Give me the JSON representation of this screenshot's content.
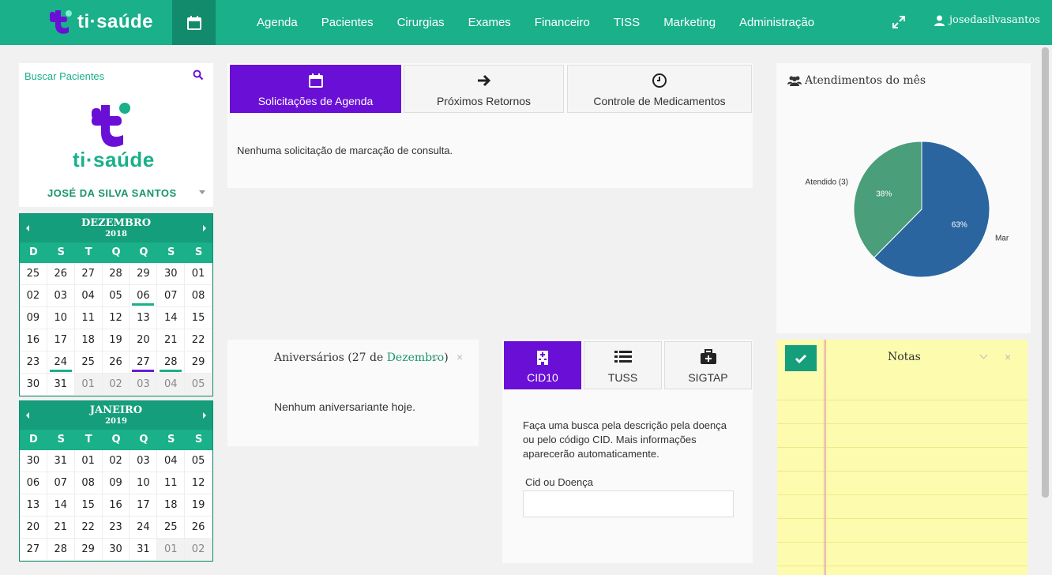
{
  "app": {
    "brand": "ti·saúde",
    "user": "josedasilvasantos"
  },
  "nav": [
    "Agenda",
    "Pacientes",
    "Cirurgias",
    "Exames",
    "Financeiro",
    "TISS",
    "Marketing",
    "Administração"
  ],
  "sidebar": {
    "search_label": "Buscar Pacientes",
    "patient_brand": "ti·saúde",
    "patient_name": "JOSÉ DA SILVA SANTOS"
  },
  "calendar_dec": {
    "month": "DEZEMBRO",
    "year": "2018",
    "dow": [
      "D",
      "S",
      "T",
      "Q",
      "Q",
      "S",
      "S"
    ],
    "days": [
      {
        "d": "25"
      },
      {
        "d": "26"
      },
      {
        "d": "27"
      },
      {
        "d": "28"
      },
      {
        "d": "29"
      },
      {
        "d": "30"
      },
      {
        "d": "01"
      },
      {
        "d": "02"
      },
      {
        "d": "03"
      },
      {
        "d": "04"
      },
      {
        "d": "05"
      },
      {
        "d": "06",
        "mark": "g"
      },
      {
        "d": "07"
      },
      {
        "d": "08"
      },
      {
        "d": "09"
      },
      {
        "d": "10"
      },
      {
        "d": "11"
      },
      {
        "d": "12"
      },
      {
        "d": "13"
      },
      {
        "d": "14"
      },
      {
        "d": "15"
      },
      {
        "d": "16"
      },
      {
        "d": "17"
      },
      {
        "d": "18"
      },
      {
        "d": "19"
      },
      {
        "d": "20"
      },
      {
        "d": "21"
      },
      {
        "d": "22"
      },
      {
        "d": "23"
      },
      {
        "d": "24",
        "mark": "g"
      },
      {
        "d": "25"
      },
      {
        "d": "26"
      },
      {
        "d": "27",
        "mark": "p"
      },
      {
        "d": "28",
        "mark": "g"
      },
      {
        "d": "29"
      },
      {
        "d": "30"
      },
      {
        "d": "31"
      },
      {
        "d": "01",
        "out": true
      },
      {
        "d": "02",
        "out": true
      },
      {
        "d": "03",
        "out": true
      },
      {
        "d": "04",
        "out": true
      },
      {
        "d": "05",
        "out": true
      }
    ]
  },
  "calendar_jan": {
    "month": "JANEIRO",
    "year": "2019",
    "dow": [
      "D",
      "S",
      "T",
      "Q",
      "Q",
      "S",
      "S"
    ],
    "days": [
      {
        "d": "30"
      },
      {
        "d": "31"
      },
      {
        "d": "01"
      },
      {
        "d": "02"
      },
      {
        "d": "03"
      },
      {
        "d": "04"
      },
      {
        "d": "05"
      },
      {
        "d": "06"
      },
      {
        "d": "07"
      },
      {
        "d": "08"
      },
      {
        "d": "09"
      },
      {
        "d": "10"
      },
      {
        "d": "11"
      },
      {
        "d": "12"
      },
      {
        "d": "13"
      },
      {
        "d": "14"
      },
      {
        "d": "15"
      },
      {
        "d": "16"
      },
      {
        "d": "17"
      },
      {
        "d": "18"
      },
      {
        "d": "19"
      },
      {
        "d": "20"
      },
      {
        "d": "21"
      },
      {
        "d": "22"
      },
      {
        "d": "23"
      },
      {
        "d": "24"
      },
      {
        "d": "25"
      },
      {
        "d": "26"
      },
      {
        "d": "27"
      },
      {
        "d": "28"
      },
      {
        "d": "29"
      },
      {
        "d": "30"
      },
      {
        "d": "31"
      },
      {
        "d": "01",
        "out": true
      },
      {
        "d": "02",
        "out": true
      }
    ]
  },
  "agenda": {
    "tabs": [
      "Solicitações de Agenda",
      "Próximos Retornos",
      "Controle de Medicamentos"
    ],
    "message": "Nenhuma solicitação de marcação de consulta."
  },
  "chart_panel": {
    "title": "Atendimentos do mês"
  },
  "chart_data": {
    "type": "pie",
    "labels": [
      "Atendido (3)",
      "Mar"
    ],
    "values": [
      38,
      63
    ],
    "value_labels": [
      "38%",
      "63%"
    ],
    "colors": [
      "#4a9e7a",
      "#2a65a0"
    ]
  },
  "aniversarios": {
    "title_prefix": "Aniversários (27 de ",
    "title_month": "Dezembro",
    "title_suffix": ")",
    "message": "Nenhum aniversariante hoje.",
    "close": "×"
  },
  "cid": {
    "tabs": [
      "CID10",
      "TUSS",
      "SIGTAP"
    ],
    "description": "Faça uma busca pela descrição pela doença ou pelo código CID. Mais informações aparecerão automaticamente.",
    "field_label": "Cid ou Doença",
    "field_value": ""
  },
  "notes": {
    "title": "Notas",
    "close": "×"
  },
  "colors": {
    "primary": "#19b08a",
    "purple": "#6a0fd6",
    "note_yellow": "#fdfbae"
  }
}
